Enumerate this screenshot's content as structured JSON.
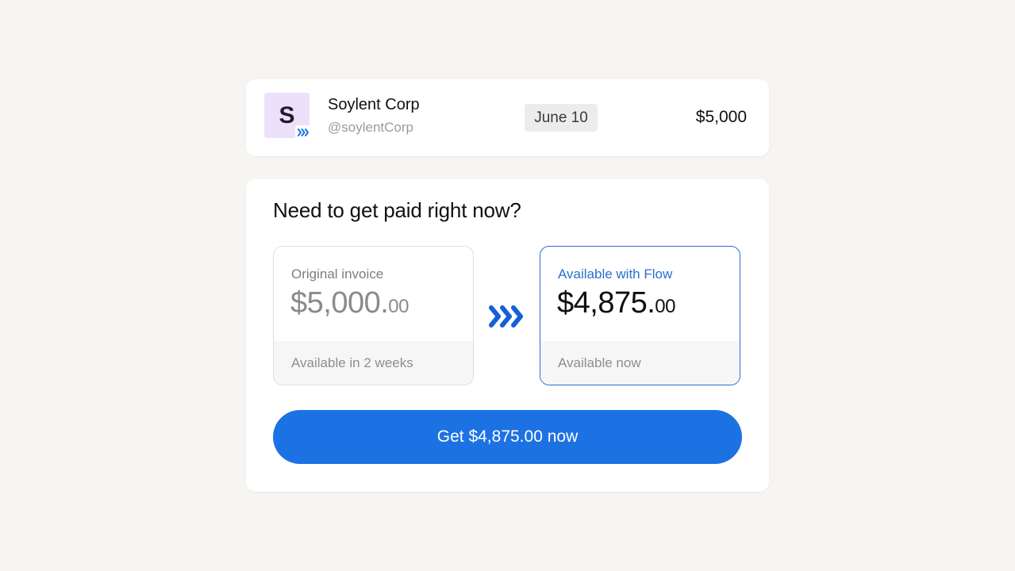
{
  "invoice": {
    "avatar_letter": "S",
    "company_name": "Soylent Corp",
    "handle": "@soylentCorp",
    "date": "June 10",
    "amount": "$5,000"
  },
  "offer": {
    "heading": "Need to get paid right now?",
    "original": {
      "label": "Original invoice",
      "amount_main": "$5,000.",
      "amount_cents": "00",
      "availability": "Available in 2 weeks"
    },
    "arrow_icon": "triple-chevron-right-icon",
    "flow": {
      "label": "Available with Flow",
      "amount_main": "$4,875.",
      "amount_cents": "00",
      "availability": "Available now"
    },
    "cta_label": "Get $4,875.00 now"
  },
  "colors": {
    "background": "#f6f5f2",
    "accent": "#1d72e3",
    "flow_border": "#2a6fcf",
    "avatar_bg": "#ede0fb"
  }
}
